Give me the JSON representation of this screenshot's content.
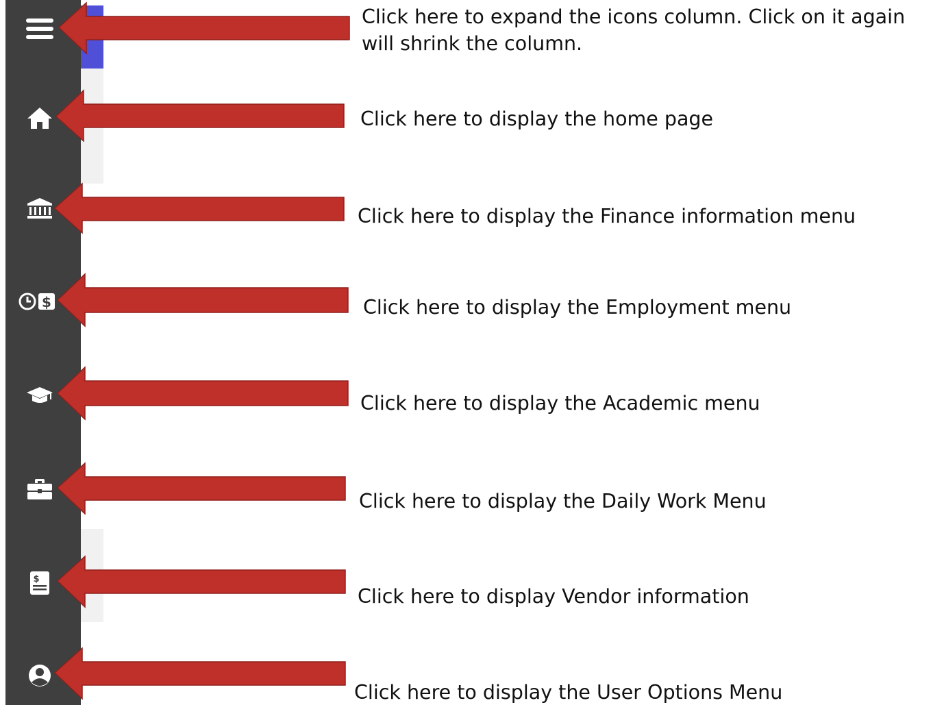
{
  "sidebar": {
    "items": [
      {
        "id": "menu",
        "icon": "hamburger-menu-icon"
      },
      {
        "id": "home",
        "icon": "home-icon"
      },
      {
        "id": "finance",
        "icon": "bank-icon"
      },
      {
        "id": "employment",
        "icon": "clock-dollar-icon"
      },
      {
        "id": "academic",
        "icon": "graduation-cap-icon"
      },
      {
        "id": "daily-work",
        "icon": "briefcase-icon"
      },
      {
        "id": "vendor",
        "icon": "invoice-icon"
      },
      {
        "id": "user-options",
        "icon": "user-circle-icon"
      }
    ]
  },
  "annotations": {
    "menu": "Click here to expand the icons column. Click on it again will shrink the column.",
    "home": "Click here to display the home page",
    "finance": "Click here to display the Finance information menu",
    "employment": "Click here to display the Employment menu",
    "academic": "Click here to display the Academic menu",
    "daily_work": "Click here to display the Daily Work Menu",
    "vendor": "Click here to display Vendor information",
    "user_options": "Click here to display the User Options Menu"
  },
  "colors": {
    "rail": "#3f3f3f",
    "accent": "#4f4fd8",
    "arrow": "#c0302b",
    "text": "#111111"
  }
}
